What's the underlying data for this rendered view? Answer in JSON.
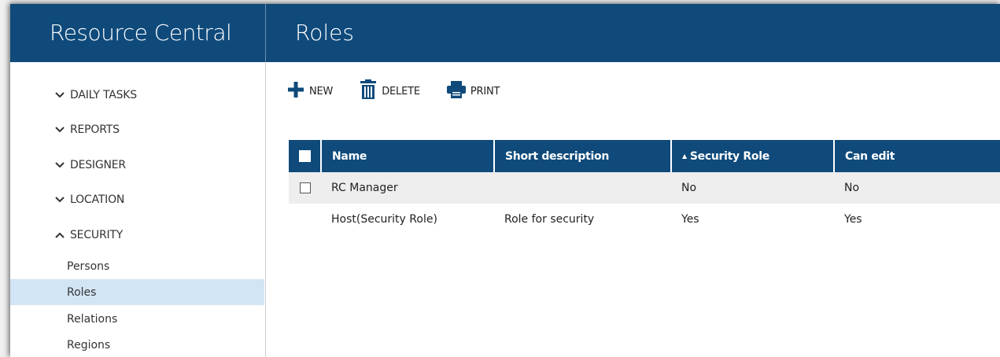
{
  "app": {
    "title": "Resource Central"
  },
  "page": {
    "title": "Roles"
  },
  "colors": {
    "brand": "#0f4a7b",
    "selected_bg": "#d2e5f5",
    "alt_row": "#eeeeee"
  },
  "sidebar": {
    "groups": [
      {
        "label": "DAILY TASKS",
        "icon": "chevron-down-icon",
        "expanded": false
      },
      {
        "label": "REPORTS",
        "icon": "chevron-down-icon",
        "expanded": false
      },
      {
        "label": "DESIGNER",
        "icon": "chevron-down-icon",
        "expanded": false
      },
      {
        "label": "LOCATION",
        "icon": "chevron-down-icon",
        "expanded": false
      },
      {
        "label": "SECURITY",
        "icon": "chevron-up-icon",
        "expanded": true
      }
    ],
    "security_items": [
      {
        "label": "Persons"
      },
      {
        "label": "Roles",
        "active": true
      },
      {
        "label": "Relations"
      },
      {
        "label": "Regions"
      }
    ]
  },
  "toolbar": {
    "new_label": "NEW",
    "delete_label": "DELETE",
    "print_label": "PRINT"
  },
  "table": {
    "columns": [
      "Name",
      "Short description",
      "Security Role",
      "Can edit"
    ],
    "sort_column": "Security Role",
    "rows": [
      {
        "name": "RC Manager",
        "short_description": "",
        "security_role": "No",
        "can_edit": "No",
        "checkbox": true
      },
      {
        "name": "Host(Security Role)",
        "short_description": "Role for security",
        "security_role": "Yes",
        "can_edit": "Yes",
        "checkbox": false
      }
    ]
  }
}
